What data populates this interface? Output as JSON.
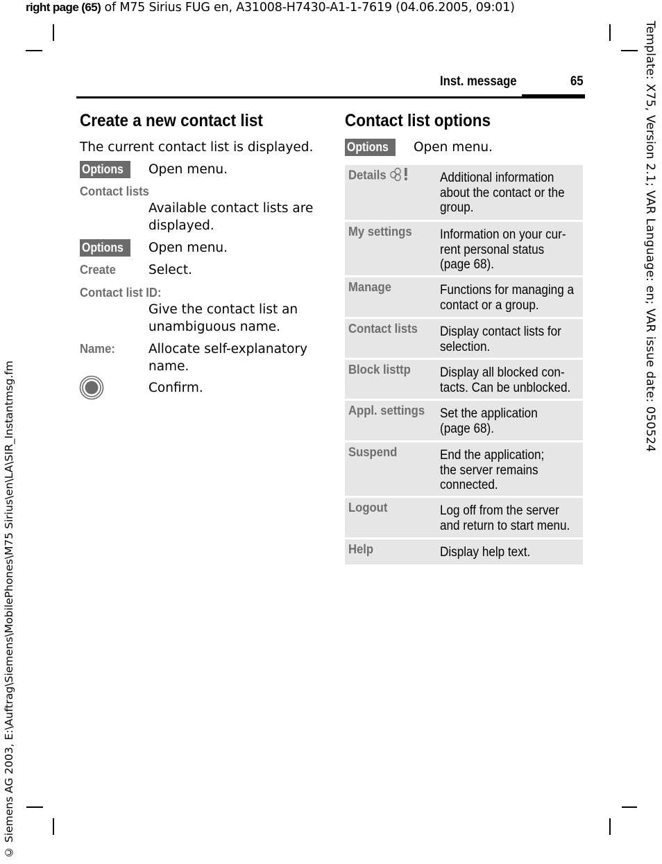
{
  "top_line": {
    "bold": "right page (65)",
    "rest": " of M75 Sirius FUG en, A31008-H7430-A1-1-7619 (04.06.2005, 09:01)"
  },
  "right_margin_text": "Template: X75, Version 2.1; VAR Language: en; VAR issue date: 050524",
  "left_margin_text": "© Siemens AG 2003, E:\\Auftrag\\Siemens\\MobilePhones\\M75 Sirius\\en\\LA\\SIR_Instantmsg.fm",
  "header": {
    "section": "Inst. message",
    "page_number": "65"
  },
  "left_column": {
    "title": "Create a new contact list",
    "intro": "The current contact list is displayed.",
    "steps": [
      {
        "key": "Options",
        "key_type": "softkey",
        "text": "Open menu."
      },
      {
        "key": "Contact lists",
        "key_type": "label",
        "text": "Available contact lists are\ndisplayed."
      },
      {
        "key": "Options",
        "key_type": "softkey",
        "text": "Open menu."
      },
      {
        "key": "Create",
        "key_type": "label",
        "text": "Select."
      },
      {
        "key": "Contact list ID:",
        "key_type": "label",
        "text": "Give the contact list an\nunambiguous name."
      },
      {
        "key": "Name:",
        "key_type": "label",
        "text": "Allocate self-explanatory\nname."
      },
      {
        "key": "confirm-key-icon",
        "key_type": "icon",
        "text": "Confirm."
      }
    ]
  },
  "right_column": {
    "title": "Contact list options",
    "softkey": "Options",
    "softkey_text": "Open menu.",
    "options": [
      {
        "name": "Details",
        "icon": "contact-group-icon",
        "text": "Additional information\nabout the contact or the\ngroup."
      },
      {
        "name": "My settings",
        "text": "Information on your cur-\nrent personal status\n(page 68)."
      },
      {
        "name": "Manage",
        "text": "Functions for managing a\ncontact or a group."
      },
      {
        "name": "Contact lists",
        "text": "Display contact lists for\nselection."
      },
      {
        "name": "Block listtp",
        "text": "Display all blocked con-\ntacts. Can be unblocked."
      },
      {
        "name": "Appl. settings",
        "text": "Set the application\n(page 68)."
      },
      {
        "name": "Suspend",
        "text": "End the application;\nthe server remains\nconnected."
      },
      {
        "name": "Logout",
        "text": "Log off from the server\nand return to start menu."
      },
      {
        "name": "Help",
        "text": "Display help text."
      }
    ]
  },
  "colors": {
    "softkey_bg": "#6b6b6b",
    "label_gray": "#6e6e6e",
    "table_row_bg": "#e6e6e6"
  }
}
